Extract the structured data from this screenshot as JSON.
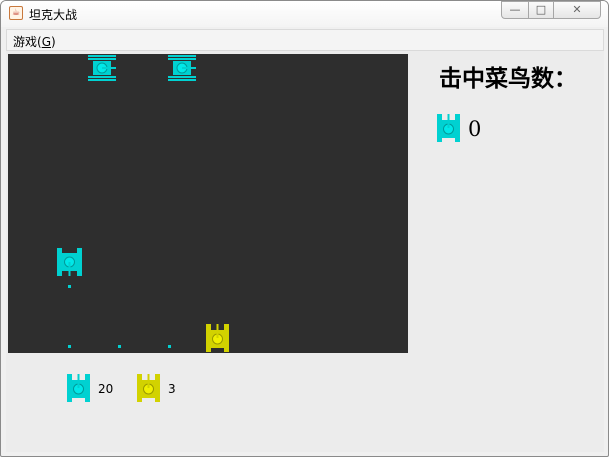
{
  "window": {
    "title": "坦克大战",
    "controls": {
      "minimize": "—",
      "maximize": "□",
      "close": "✕"
    }
  },
  "menubar": {
    "game_menu_label": "游戏(",
    "game_menu_mnemonic": "G",
    "game_menu_suffix": ")"
  },
  "colors": {
    "enemy_tank": "#00d1d1",
    "player_tank": "#d2d200",
    "arena_background": "#2e2e2e",
    "panel_background": "#ececec"
  },
  "icons": {
    "enemy_tank": "enemy-tank-icon",
    "player_tank": "player-tank-icon",
    "bullet": "bullet-icon"
  },
  "scoreboard": {
    "title": "击中菜鸟数：",
    "hits_value": "0"
  },
  "status": {
    "enemy_remaining": "20",
    "player_lives": "3"
  }
}
